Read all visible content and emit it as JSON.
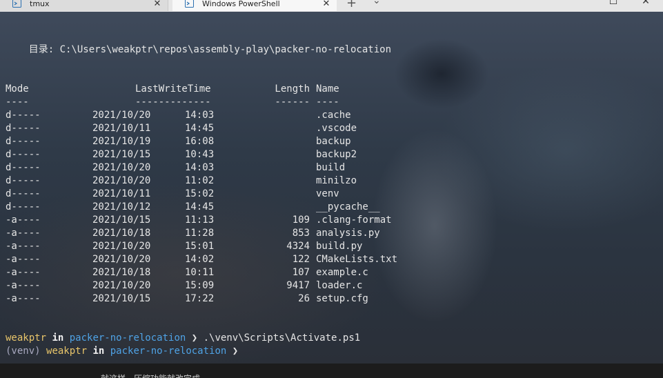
{
  "tabs": [
    {
      "label": "tmux",
      "close": "✕"
    },
    {
      "label": "Windows PowerShell",
      "close": "✕"
    }
  ],
  "tabbar": {
    "new_tab": "+",
    "dropdown": "⌄",
    "maximize": "☐",
    "close": "✕"
  },
  "terminal": {
    "directory_line": "    目录: C:\\Users\\weakptr\\repos\\assembly-play\\packer-no-relocation",
    "headers": {
      "mode": "Mode",
      "lastwritetime": "LastWriteTime",
      "length": "Length",
      "name": "Name"
    },
    "underlines": {
      "mode": "----",
      "lastwritetime": "-------------",
      "length": "------",
      "name": "----"
    },
    "rows": [
      {
        "mode": "d-----",
        "date": "2021/10/20",
        "time": "14:03",
        "length": "",
        "name": ".cache"
      },
      {
        "mode": "d-----",
        "date": "2021/10/11",
        "time": "14:45",
        "length": "",
        "name": ".vscode"
      },
      {
        "mode": "d-----",
        "date": "2021/10/19",
        "time": "16:08",
        "length": "",
        "name": "backup"
      },
      {
        "mode": "d-----",
        "date": "2021/10/15",
        "time": "10:43",
        "length": "",
        "name": "backup2"
      },
      {
        "mode": "d-----",
        "date": "2021/10/20",
        "time": "14:03",
        "length": "",
        "name": "build"
      },
      {
        "mode": "d-----",
        "date": "2021/10/20",
        "time": "11:02",
        "length": "",
        "name": "minilzo"
      },
      {
        "mode": "d-----",
        "date": "2021/10/11",
        "time": "15:02",
        "length": "",
        "name": "venv"
      },
      {
        "mode": "d-----",
        "date": "2021/10/12",
        "time": "14:45",
        "length": "",
        "name": "__pycache__"
      },
      {
        "mode": "-a----",
        "date": "2021/10/15",
        "time": "11:13",
        "length": "109",
        "name": ".clang-format"
      },
      {
        "mode": "-a----",
        "date": "2021/10/18",
        "time": "11:28",
        "length": "853",
        "name": "analysis.py"
      },
      {
        "mode": "-a----",
        "date": "2021/10/20",
        "time": "15:01",
        "length": "4324",
        "name": "build.py"
      },
      {
        "mode": "-a----",
        "date": "2021/10/20",
        "time": "14:02",
        "length": "122",
        "name": "CMakeLists.txt"
      },
      {
        "mode": "-a----",
        "date": "2021/10/18",
        "time": "10:11",
        "length": "107",
        "name": "example.c"
      },
      {
        "mode": "-a----",
        "date": "2021/10/20",
        "time": "15:09",
        "length": "9417",
        "name": "loader.c"
      },
      {
        "mode": "-a----",
        "date": "2021/10/15",
        "time": "17:22",
        "length": "26",
        "name": "setup.cfg"
      }
    ],
    "prompt1": {
      "user": "weakptr",
      "in": " in ",
      "dir": "packer-no-relocation",
      "arrow": " ❯ ",
      "command": ".\\venv\\Scripts\\Activate.ps1"
    },
    "prompt2": {
      "venv": "(venv) ",
      "user": "weakptr",
      "in": " in ",
      "dir": "packer-no-relocation",
      "arrow": " ❯"
    }
  },
  "bottombar": {
    "text": "就这样，压缩功能就改完成"
  },
  "colors": {
    "user": "#e8c56a",
    "dir": "#4fa3e6",
    "text": "#e6e6e6"
  }
}
